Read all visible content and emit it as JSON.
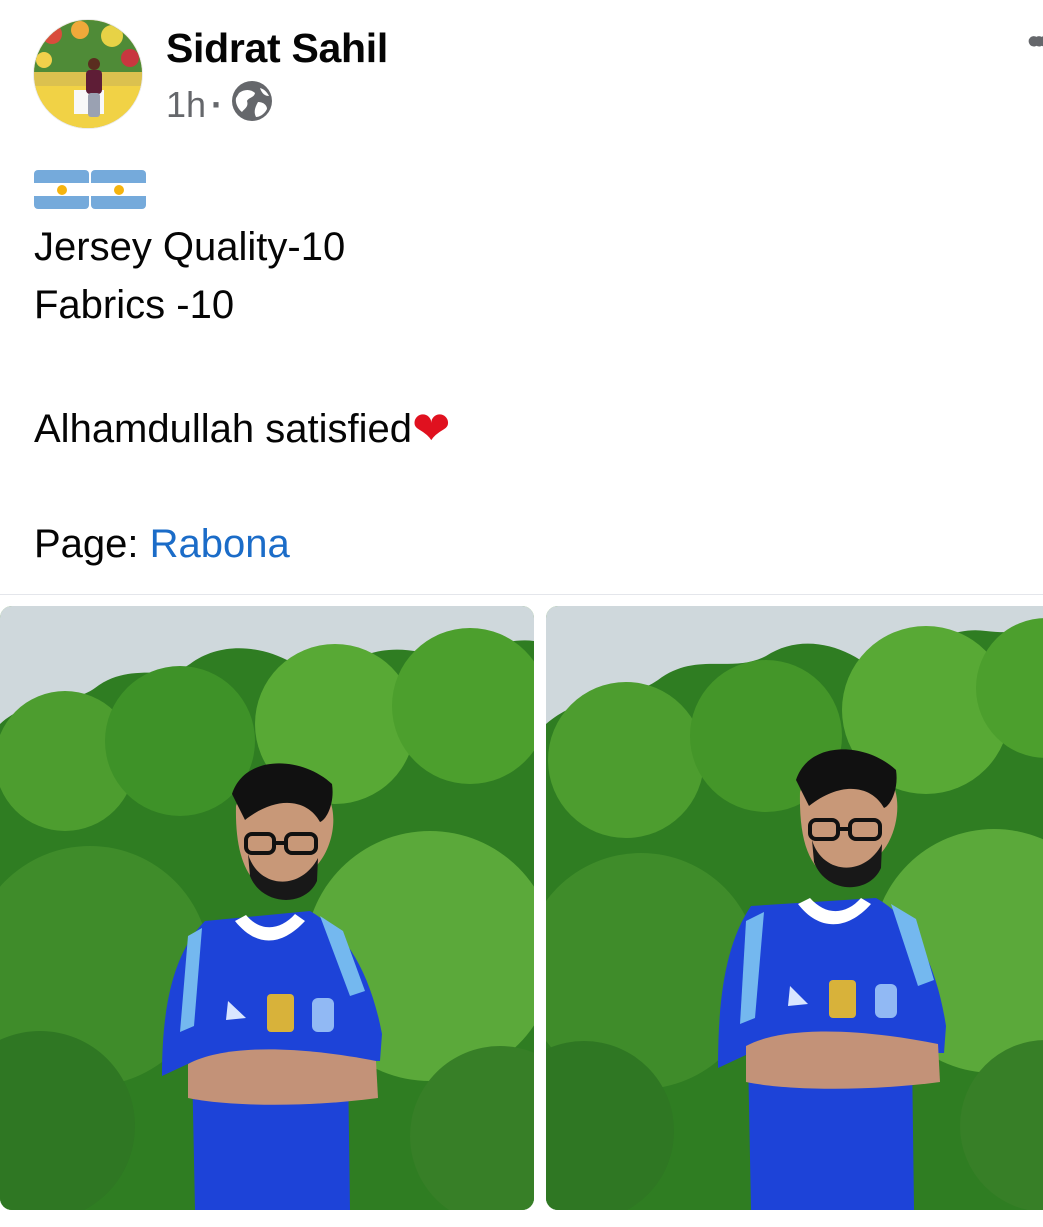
{
  "post": {
    "author": "Sidrat Sahil",
    "time": "1h",
    "separator": "·",
    "privacy_icon": "globe-icon",
    "more_icon": "more-options-icon",
    "more_label": "•••",
    "flags": [
      "🇦🇷",
      "🇦🇷"
    ],
    "line_1": "Jersey Quality-10",
    "line_2": "Fabrics -10",
    "line_3": "Alhamdullah satisfied",
    "heart": "❤",
    "page_prefix": "Page:",
    "page_link": "Rabona"
  },
  "photos": [
    {
      "name": "photo-1",
      "subject": "man-in-argentina-away-jersey"
    },
    {
      "name": "photo-2",
      "subject": "man-in-argentina-away-jersey"
    }
  ],
  "colors": {
    "link": "#1b6cc8",
    "meta": "#65676b",
    "heart": "#e0111f",
    "jersey": "#1d43d8"
  }
}
